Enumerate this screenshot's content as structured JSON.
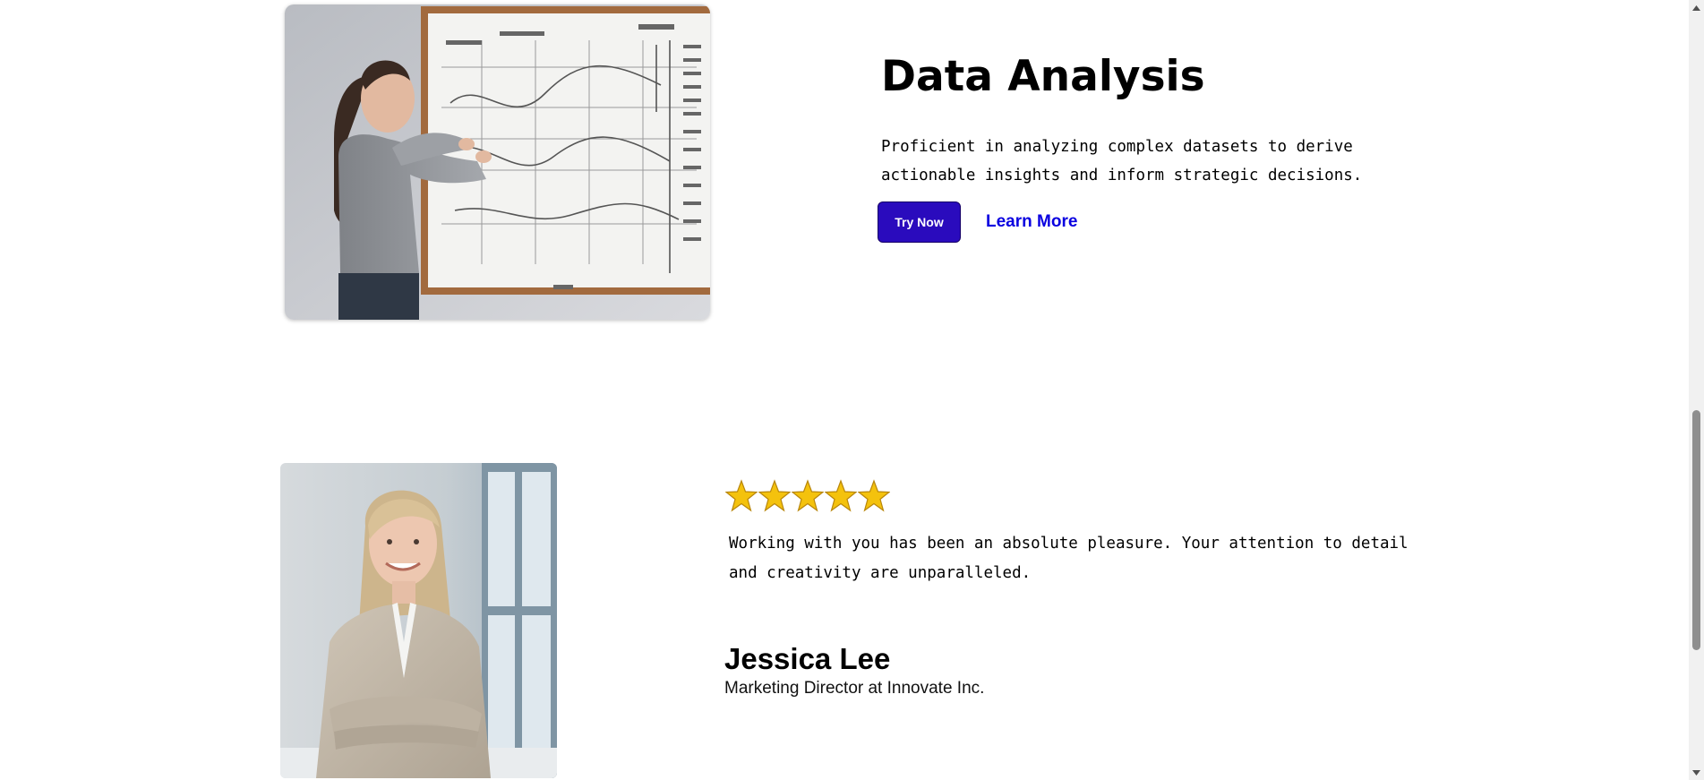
{
  "feature": {
    "title": "Data Analysis",
    "description": "Proficient in analyzing complex datasets to derive actionable insights and inform strategic decisions.",
    "primary_button_label": "Try Now",
    "secondary_link_label": "Learn More",
    "image_alt": "Woman pointing at a whiteboard full of charts"
  },
  "testimonial": {
    "rating": 5,
    "rating_max": 5,
    "quote": "Working with you has been an absolute pleasure. Your attention to detail and creativity are unparalleled.",
    "author_name": "Jessica Lee",
    "author_role": "Marketing Director at Innovate Inc.",
    "image_alt": "Smiling woman in a beige blazer with arms crossed"
  },
  "colors": {
    "primary_button": "#2a0bbd",
    "link": "#0a00e0",
    "star": "#f4c20d",
    "scrollbar_thumb": "#8e8e8e"
  },
  "icons": {
    "star": "star-icon",
    "scroll_up": "chevron-up-icon",
    "scroll_down": "chevron-down-icon"
  }
}
